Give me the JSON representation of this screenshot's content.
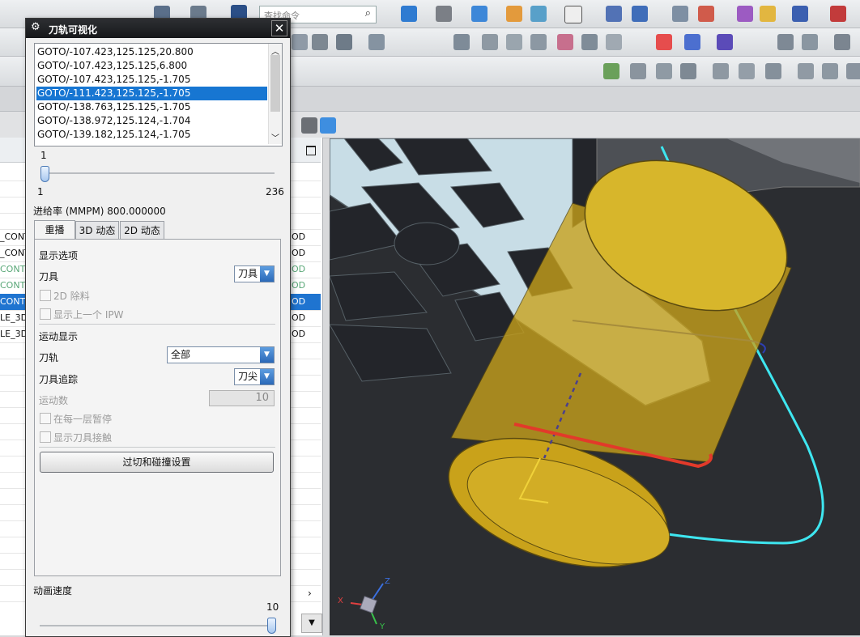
{
  "toolbar": {
    "search_placeholder": "查找命令"
  },
  "navigator": {
    "rows": [
      {
        "left": "_CONT",
        "right": "OD",
        "state": "normal"
      },
      {
        "left": "_CONT",
        "right": "OD",
        "state": "normal"
      },
      {
        "left": "CONT",
        "right": "OD",
        "state": "green"
      },
      {
        "left": "CONT",
        "right": "OD",
        "state": "green"
      },
      {
        "left": "CONT",
        "right": "OD",
        "state": "selected"
      },
      {
        "left": "LE_3D",
        "right": "OD",
        "state": "normal"
      },
      {
        "left": "LE_3D",
        "right": "OD",
        "state": "normal"
      }
    ]
  },
  "dialog": {
    "title": "刀轨可视化",
    "close_label": "✕",
    "goto_list": [
      "GOTO/-107.423,125.125,20.800",
      "GOTO/-107.423,125.125,6.800",
      "GOTO/-107.423,125.125,-1.705",
      "GOTO/-111.423,125.125,-1.705",
      "GOTO/-138.763,125.125,-1.705",
      "GOTO/-138.972,125.124,-1.704",
      "GOTO/-139.182,125.124,-1.705"
    ],
    "selected_index": 3,
    "step_slider": {
      "current": "1",
      "min": "1",
      "max": "236",
      "fraction": 0.0
    },
    "feedrate": "进给率 (MMPM) 800.000000",
    "tabs": [
      "重播",
      "3D 动态",
      "2D 动态"
    ],
    "display_options_label": "显示选项",
    "tool_label": "刀具",
    "tool_value": "刀具",
    "remove_2d_label": "2D 除料",
    "show_prev_ipw_label": "显示上一个 IPW",
    "motion_display_label": "运动显示",
    "toolpath_label": "刀轨",
    "toolpath_value": "全部",
    "tool_trace_label": "刀具追踪",
    "tool_trace_value": "刀尖",
    "motion_count_label": "运动数",
    "motion_count_value": "10",
    "pause_each_layer_label": "在每一层暂停",
    "show_tool_contact_label": "显示刀具接触",
    "gouge_button_label": "过切和碰撞设置",
    "anim_speed_label": "动画速度",
    "anim_speed": {
      "value": "10",
      "fraction": 1.0
    }
  },
  "triad": {
    "x": "X",
    "y": "Y",
    "z": "Z"
  },
  "colors": {
    "selection": "#1776d2",
    "toolpath_cyan": "#3ee6f0",
    "tool_gold": "#c9a21a"
  }
}
